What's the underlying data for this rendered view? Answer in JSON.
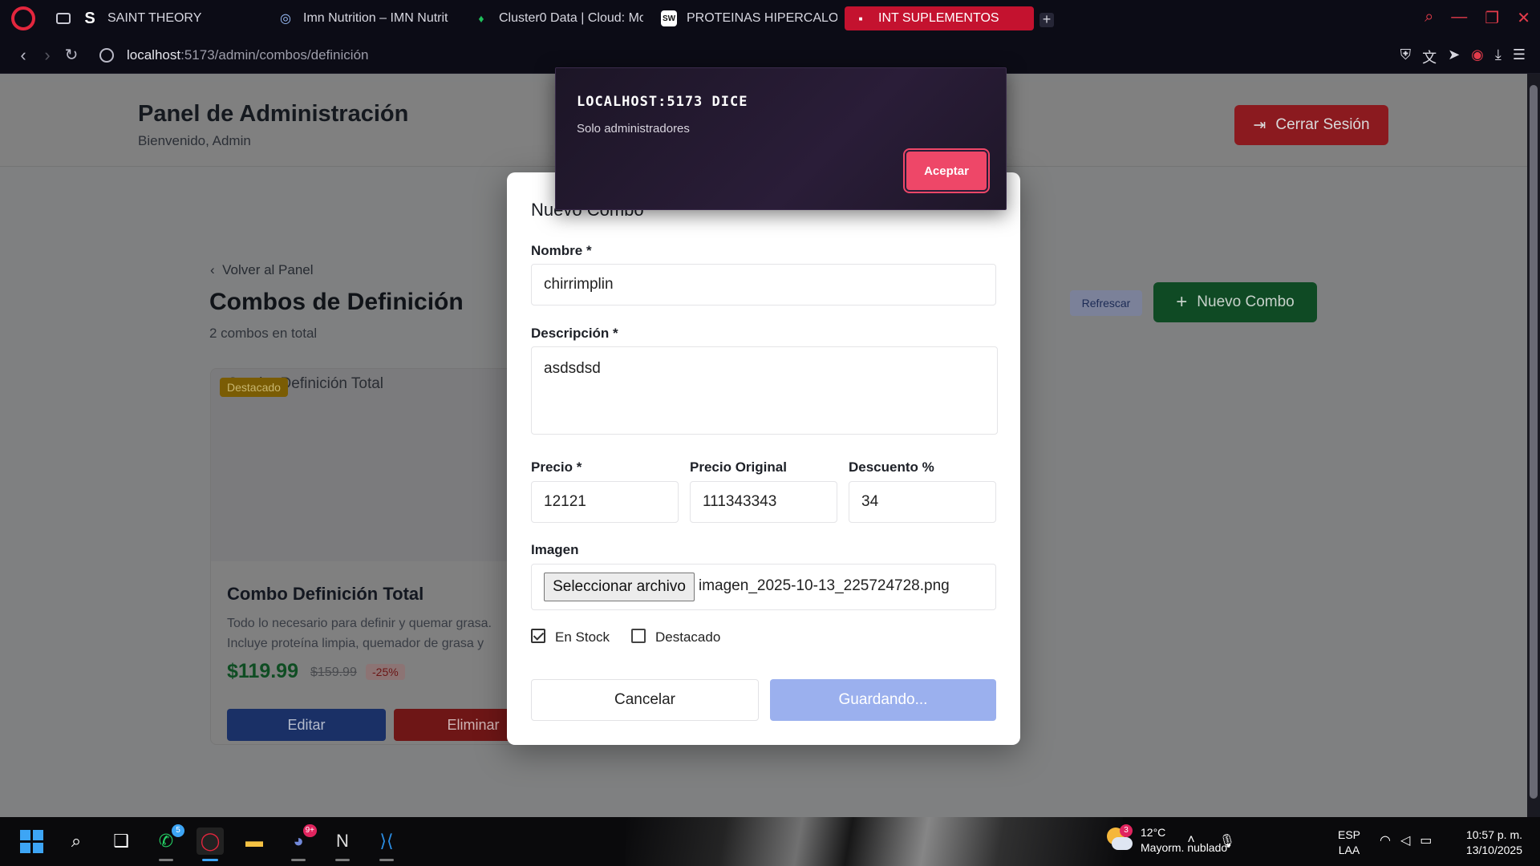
{
  "browser": {
    "tabs": [
      {
        "label": "SAINT THEORY",
        "icon": "S"
      },
      {
        "label": "Imn Nutrition – IMN Nutrit",
        "icon": "◎"
      },
      {
        "label": "Cluster0 Data | Cloud: Mo",
        "icon": "♦"
      },
      {
        "label": "PROTEINAS HIPERCALOR",
        "icon": "SW"
      },
      {
        "label": "INT SUPLEMENTOS",
        "icon": "■"
      }
    ],
    "new_tab_label": "+",
    "url_host": "localhost",
    "url_path": ":5173/admin/combos/definición"
  },
  "page": {
    "admin_title": "Panel de Administración",
    "admin_subtitle": "Bienvenido, Admin",
    "logout_label": "Cerrar Sesión",
    "back_label": "Volver al Panel",
    "title": "Combos de Definición",
    "subtitle": "2 combos en total",
    "refresh_label": "Refrescar",
    "new_combo_label": "Nuevo Combo",
    "card": {
      "image_alt": "Combo Definición Total",
      "badge": "Destacado",
      "title": "Combo Definición Total",
      "desc_line1": "Todo lo necesario para definir y quemar grasa.",
      "desc_line2": "Incluye proteína limpia, quemador de grasa y",
      "price": "$119.99",
      "old_price": "$159.99",
      "discount": "-25%",
      "edit_label": "Editar",
      "delete_label": "Eliminar"
    }
  },
  "modal": {
    "title": "Nuevo Combo",
    "name_label": "Nombre *",
    "name_value": "chirrimplin",
    "desc_label": "Descripción *",
    "desc_value": "asdsdsd",
    "price_label": "Precio *",
    "price_value": "12121",
    "original_price_label": "Precio Original",
    "original_price_value": "111343343",
    "discount_label": "Descuento %",
    "discount_value": "34",
    "image_label": "Imagen",
    "file_button_label": "Seleccionar archivo",
    "file_name": "imagen_2025-10-13_225724728.png",
    "in_stock_label": "En Stock",
    "in_stock_checked": true,
    "featured_label": "Destacado",
    "featured_checked": false,
    "cancel_label": "Cancelar",
    "save_label": "Guardando..."
  },
  "alert": {
    "title": "LOCALHOST:5173 DICE",
    "message": "Solo administradores",
    "accept_label": "Aceptar"
  },
  "taskbar": {
    "whatsapp_badge": "5",
    "discord_badge": "9+",
    "weather_badge": "3",
    "temperature": "12°C",
    "weather_desc": "Mayorm. nublado",
    "lang_line1": "ESP",
    "lang_line2": "LAA",
    "time": "10:57 p. m.",
    "date": "13/10/2025"
  },
  "colors": {
    "browser_accent": "#c4122f",
    "alert_button": "#ee4768",
    "save_button": "#9bb0ee",
    "new_combo_button": "#0f4a24",
    "logout_button": "#8b1a1f"
  }
}
